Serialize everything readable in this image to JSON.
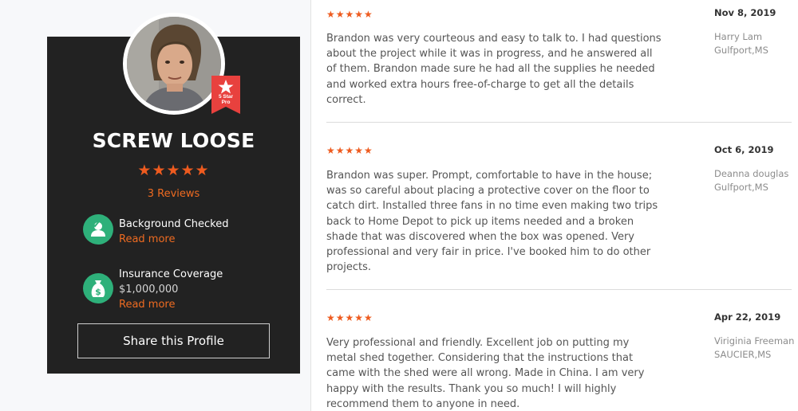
{
  "profile": {
    "name": "SCREW LOOSE",
    "badge_line1": "5 Star",
    "badge_line2": "Pro",
    "stars": "★★★★★",
    "reviews_label": "3 Reviews",
    "features": [
      {
        "title": "Background Checked",
        "link": "Read more",
        "icon": "person-check-icon"
      },
      {
        "title": "Insurance Coverage",
        "value": "$1,000,000",
        "link": "Read more",
        "icon": "money-bag-icon"
      }
    ],
    "share_label": "Share this Profile"
  },
  "reviews": [
    {
      "stars": "★★★★★",
      "text": "Brandon was very courteous and easy to talk to. I had questions about the project while it was in progress, and he answered all of them. Brandon made sure he had all the supplies he needed and worked extra hours free-of-charge to get all the details correct.",
      "date": "Nov 8, 2019",
      "author": "Harry Lam",
      "location": "Gulfport,MS"
    },
    {
      "stars": "★★★★★",
      "text": "Brandon was super. Prompt, comfortable to have in the house; was so careful about placing a protective cover on the floor to catch dirt. Installed three fans in no time even making two trips back to Home Depot to pick up items needed and a broken shade that was discovered when the box was opened. Very professional and very fair in price. I've booked him to do other projects.",
      "date": "Oct 6, 2019",
      "author": "Deanna douglas",
      "location": "Gulfport,MS"
    },
    {
      "stars": "★★★★★",
      "text": "Very professional and friendly. Excellent job on putting my metal shed together. Considering that the instructions that came with the shed were all wrong. Made in China. I am very happy with the results. Thank you so much! I will highly recommend them to anyone in need.",
      "date": "Apr 22, 2019",
      "author": "Viriginia Freeman",
      "location": "SAUCIER,MS"
    }
  ],
  "colors": {
    "accent": "#ee5b1f",
    "card_bg": "#222222",
    "feature_icon": "#2eb07a",
    "badge": "#e8413e"
  }
}
